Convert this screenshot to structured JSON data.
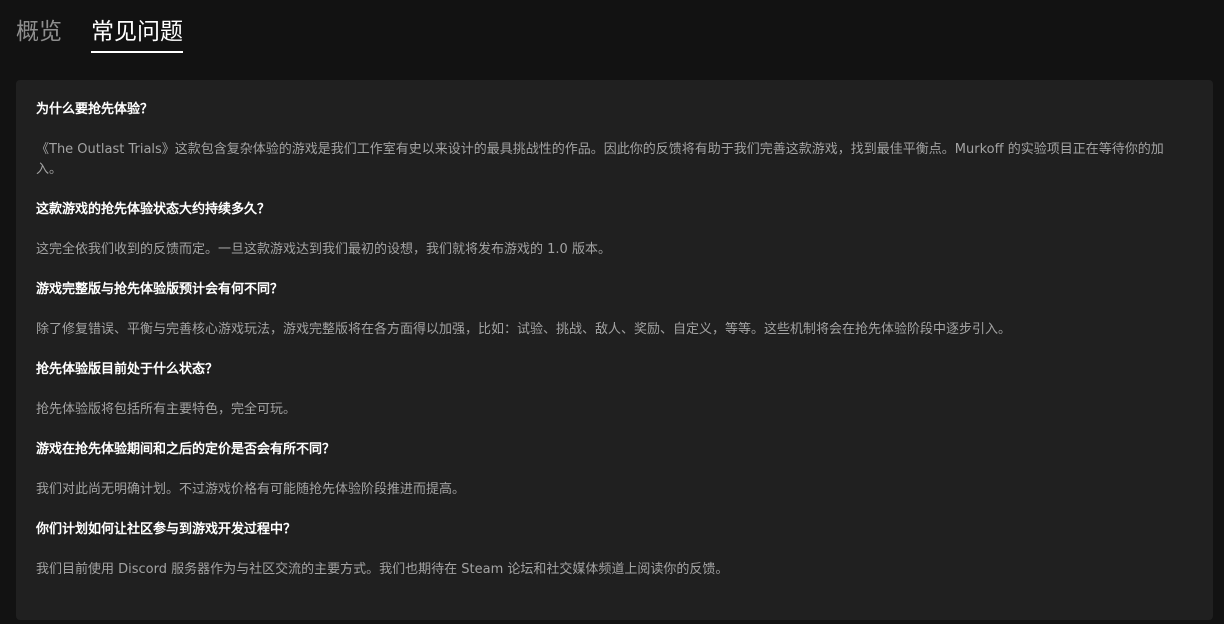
{
  "tabs": [
    {
      "label": "概览",
      "active": false
    },
    {
      "label": "常见问题",
      "active": true
    }
  ],
  "faq": [
    {
      "question": "为什么要抢先体验？",
      "answer": "《The Outlast Trials》这款包含复杂体验的游戏是我们工作室有史以来设计的最具挑战性的作品。因此你的反馈将有助于我们完善这款游戏，找到最佳平衡点。Murkoff 的实验项目正在等待你的加入。"
    },
    {
      "question": "这款游戏的抢先体验状态大约持续多久？",
      "answer": "这完全依我们收到的反馈而定。一旦这款游戏达到我们最初的设想，我们就将发布游戏的 1.0 版本。"
    },
    {
      "question": "游戏完整版与抢先体验版预计会有何不同？",
      "answer": "除了修复错误、平衡与完善核心游戏玩法，游戏完整版将在各方面得以加强，比如：试验、挑战、敌人、奖励、自定义，等等。这些机制将会在抢先体验阶段中逐步引入。"
    },
    {
      "question": "抢先体验版目前处于什么状态？",
      "answer": "抢先体验版将包括所有主要特色，完全可玩。"
    },
    {
      "question": "游戏在抢先体验期间和之后的定价是否会有所不同？",
      "answer": "我们对此尚无明确计划。不过游戏价格有可能随抢先体验阶段推进而提高。"
    },
    {
      "question": "你们计划如何让社区参与到游戏开发过程中？",
      "answer": "我们目前使用 Discord 服务器作为与社区交流的主要方式。我们也期待在 Steam 论坛和社交媒体频道上阅读你的反馈。"
    }
  ]
}
